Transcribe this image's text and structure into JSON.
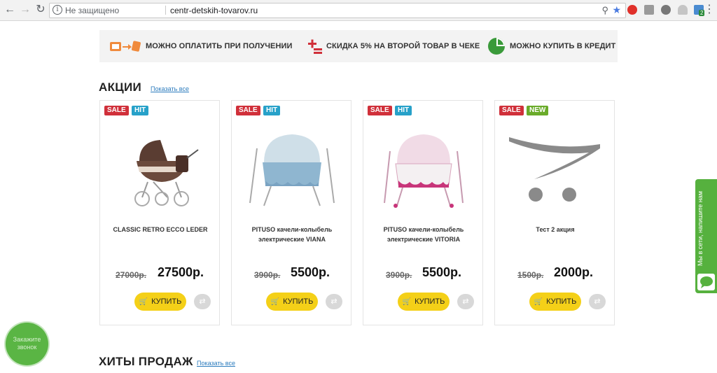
{
  "browser": {
    "security_label": "Не защищено",
    "url": "centr-detskih-tovarov.ru",
    "extension_badge": "2"
  },
  "features": [
    {
      "icon": "cash-on-delivery-icon",
      "label": "МОЖНО ОПЛАТИТЬ ПРИ ПОЛУЧЕНИИ"
    },
    {
      "icon": "discount-icon",
      "label": "СКИДКА 5% НА ВТОРОЙ ТОВАР В ЧЕКЕ"
    },
    {
      "icon": "credit-pie-icon",
      "label": "МОЖНО КУПИТЬ В КРЕДИТ"
    }
  ],
  "sections": {
    "promo": {
      "title": "АКЦИИ",
      "show_all": "Показать все"
    },
    "hits": {
      "title": "ХИТЫ ПРОДАЖ",
      "show_all": "Показать все"
    }
  },
  "products": [
    {
      "name": "CLASSIC RETRO ECCO LEDER",
      "old_price": "27000р.",
      "price": "27500р.",
      "badges": [
        "SALE",
        "HIT"
      ],
      "buy": "КУПИТЬ"
    },
    {
      "name": "PITUSO качели-колыбель электрические VIANA",
      "old_price": "3900р.",
      "price": "5500р.",
      "badges": [
        "SALE",
        "HIT"
      ],
      "buy": "КУПИТЬ"
    },
    {
      "name": "PITUSO качели-колыбель электрические VITORIA",
      "old_price": "3900р.",
      "price": "5500р.",
      "badges": [
        "SALE",
        "HIT"
      ],
      "buy": "КУПИТЬ"
    },
    {
      "name": "Тест 2 акция",
      "old_price": "1500р.",
      "price": "2000р.",
      "badges": [
        "SALE",
        "NEW"
      ],
      "buy": "КУПИТЬ"
    }
  ],
  "chat": {
    "label": "Мы в сети, напишите нам"
  },
  "callback": {
    "label": "Закажите звонок"
  },
  "colors": {
    "accent_yellow": "#f4d018",
    "sale_red": "#d0303a",
    "hit_blue": "#27a1c9",
    "new_green": "#6aab2a",
    "chat_green": "#56b13e"
  }
}
